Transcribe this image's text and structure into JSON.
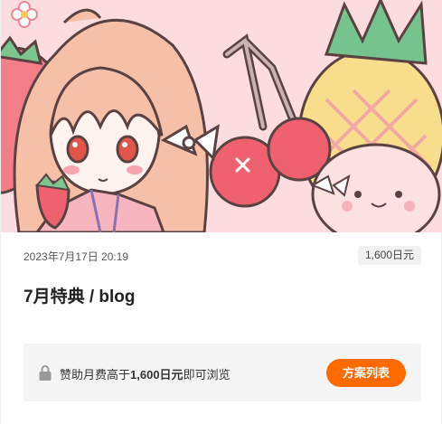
{
  "post": {
    "date": "2023年7月17日 20:19",
    "price_badge": "1,600日元",
    "title": "7月特典 / blog",
    "cover_image": "anime-girl-with-fruits-illustration"
  },
  "lock_notice": {
    "icon": "lock-icon",
    "text_before": "赞助月费高于",
    "text_amount": "1,600日元",
    "text_after": "即可浏览",
    "button_label": "方案列表"
  },
  "colors": {
    "accent": "#ff6a00",
    "badge_bg": "#f1f1f1",
    "notice_bg": "#f5f5f5"
  }
}
